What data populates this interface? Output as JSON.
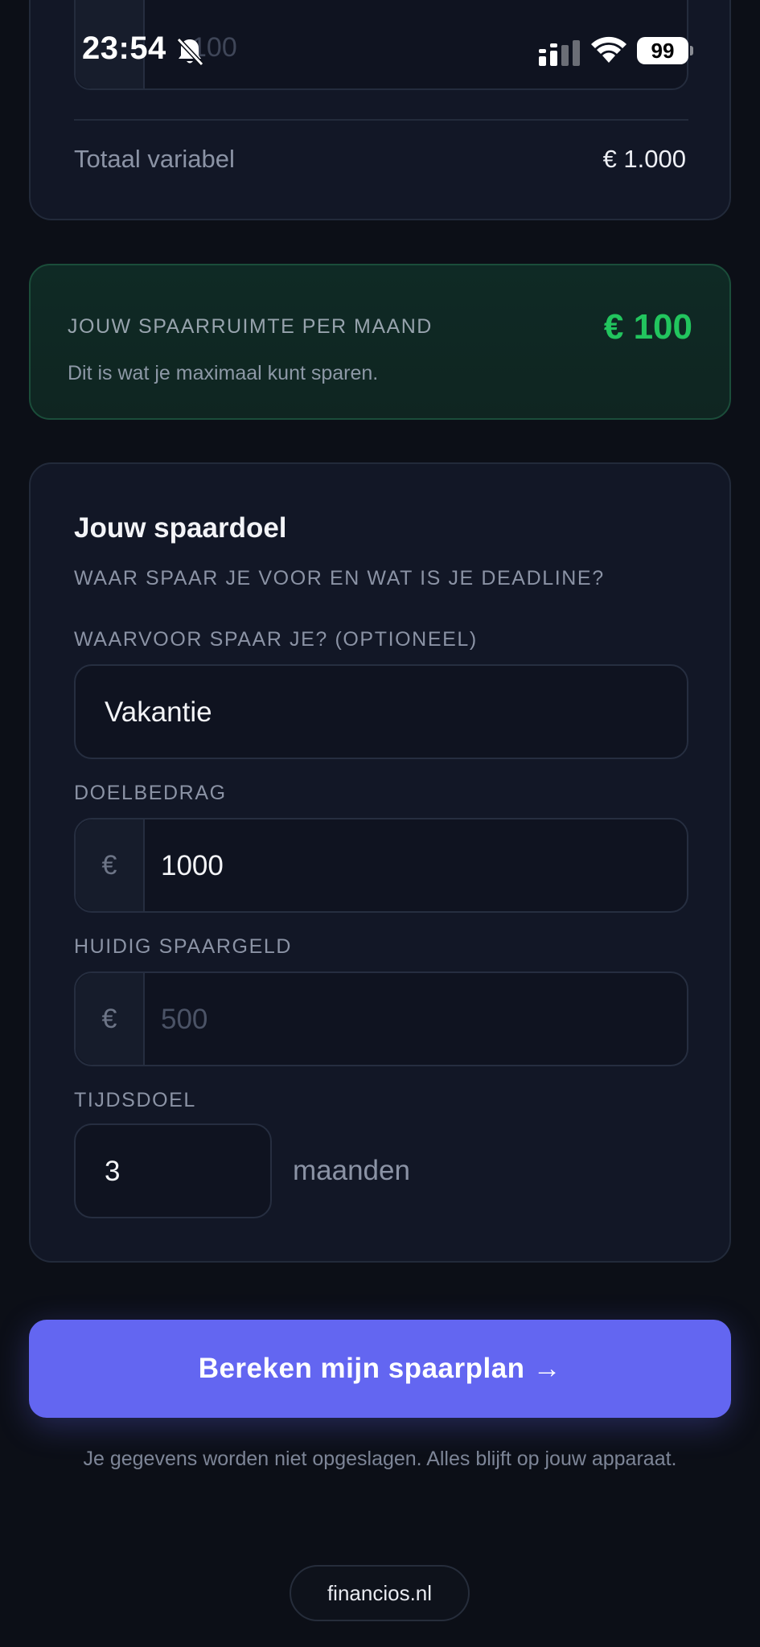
{
  "status_bar": {
    "time": "23:54",
    "battery": "99"
  },
  "variable_section": {
    "partial_input_value": "100",
    "total_label": "Totaal variabel",
    "total_value": "€ 1.000"
  },
  "savings_room": {
    "label": "JOUW SPAARRUIMTE PER MAAND",
    "value": "€ 100",
    "subtitle": "Dit is wat je maximaal kunt sparen.",
    "accent_color": "#22c55e"
  },
  "goal": {
    "title": "Jouw spaardoel",
    "subtitle": "WAAR SPAAR JE VOOR EN WAT IS JE DEADLINE?",
    "purpose_label": "WAARVOOR SPAAR JE? (OPTIONEEL)",
    "purpose_value": "Vakantie",
    "target_label": "DOELBEDRAG",
    "currency_symbol": "€",
    "target_value": "1000",
    "current_label": "HUIDIG SPAARGELD",
    "current_placeholder": "500",
    "time_label": "TIJDSDOEL",
    "time_value": "3",
    "time_unit": "maanden"
  },
  "cta": {
    "label": "Bereken mijn spaarplan →",
    "color": "#6366f1"
  },
  "privacy_note": "Je gegevens worden niet opgeslagen. Alles blijft op jouw apparaat.",
  "footer": {
    "brand": "financios.nl"
  },
  "icons": [
    "bell-slash-icon",
    "cellular-signal-icon",
    "wifi-icon",
    "battery-icon"
  ]
}
